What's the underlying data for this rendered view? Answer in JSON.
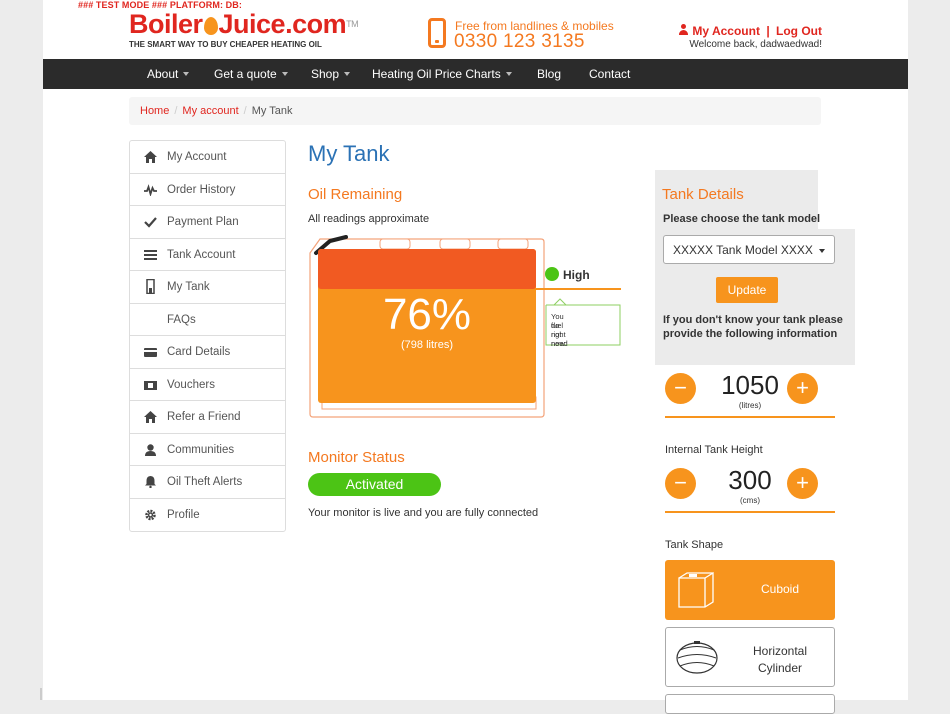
{
  "banner": "### TEST MODE ### PLATFORM: DB:",
  "brand": {
    "logo_left": "Boiler",
    "logo_right": "Juice.com",
    "tm": "TM",
    "tagline": "THE SMART WAY TO BUY CHEAPER HEATING OIL",
    "phone_caption": "Free from landlines & mobiles",
    "phone_number": "0330 123 3135",
    "accent": "#e0261f",
    "orange": "#f47920"
  },
  "account": {
    "my_account": "My Account",
    "sep": "|",
    "logout": "Log Out",
    "welcome": "Welcome back, dadwaedwad!"
  },
  "nav": [
    {
      "label": "About",
      "dropdown": true
    },
    {
      "label": "Get a quote",
      "dropdown": true
    },
    {
      "label": "Shop",
      "dropdown": true
    },
    {
      "label": "Heating Oil Price Charts",
      "dropdown": true
    },
    {
      "label": "Blog",
      "dropdown": false
    },
    {
      "label": "Contact",
      "dropdown": false
    }
  ],
  "breadcrumb": {
    "home": "Home",
    "account": "My account",
    "current": "My Tank",
    "sep": "/"
  },
  "sidebar": [
    {
      "label": "My Account",
      "icon": "home-icon"
    },
    {
      "label": "Order History",
      "icon": "activity-icon"
    },
    {
      "label": "Payment Plan",
      "icon": "check-icon"
    },
    {
      "label": "Tank Account",
      "icon": "list-icon"
    },
    {
      "label": "My Tank",
      "icon": "tank-icon"
    },
    {
      "label": "FAQs",
      "icon": ""
    },
    {
      "label": "Card Details",
      "icon": "card-icon"
    },
    {
      "label": "Vouchers",
      "icon": "voucher-icon"
    },
    {
      "label": "Refer a Friend",
      "icon": "home-icon"
    },
    {
      "label": "Communities",
      "icon": "user-icon"
    },
    {
      "label": "Oil Theft Alerts",
      "icon": "bell-icon"
    },
    {
      "label": "Profile",
      "icon": "gear-icon"
    }
  ],
  "main": {
    "title": "My Tank",
    "oil_remaining_title": "Oil Remaining",
    "readings_note": "All readings approximate",
    "tank": {
      "percent_label": "76%",
      "litres_label": "(798 litres)",
      "level": 0.76,
      "level_label": "High",
      "level_note_line1": "You do not need",
      "level_note_line2": "fuel right now",
      "level_color": "#4cc415"
    },
    "monitor_title": "Monitor Status",
    "monitor_status": "Activated",
    "monitor_text": "Your monitor is live and you are fully connected"
  },
  "details": {
    "title": "Tank Details",
    "choose_label": "Please choose the tank model",
    "model_selected": "XXXXX Tank Model XXXX",
    "update_label": "Update",
    "info_text": "If you don't know your tank please provide the following information",
    "volume": {
      "value": "1050",
      "unit": "(litres)",
      "minus": "−",
      "plus": "+"
    },
    "height_label": "Internal Tank Height",
    "height": {
      "value": "300",
      "unit": "(cms)",
      "minus": "−",
      "plus": "+"
    },
    "shape_label": "Tank Shape",
    "shapes": [
      {
        "label": "Cuboid",
        "selected": true
      },
      {
        "label_line1": "Horizontal",
        "label_line2": "Cylinder",
        "selected": false
      }
    ]
  }
}
